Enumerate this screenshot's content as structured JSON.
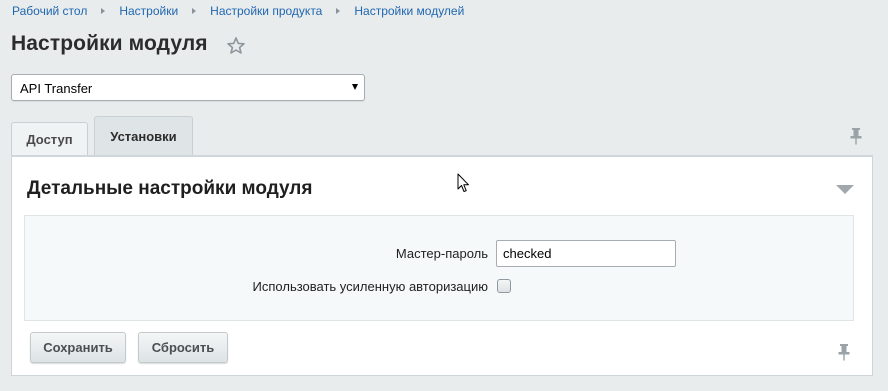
{
  "breadcrumb": [
    "Рабочий стол",
    "Настройки",
    "Настройки продукта",
    "Настройки модулей"
  ],
  "page": {
    "title": "Настройки модуля"
  },
  "module_select": {
    "selected": "API Transfer"
  },
  "tabs": [
    {
      "label": "Доступ",
      "active": false
    },
    {
      "label": "Установки",
      "active": true
    }
  ],
  "section": {
    "title": "Детальные настройки модуля"
  },
  "form": {
    "master_password_label": "Мастер-пароль",
    "master_password_value": "checked",
    "strong_auth_label": "Использовать усиленную авторизацию",
    "strong_auth_checked": false
  },
  "buttons": {
    "save": "Сохранить",
    "reset": "Сбросить"
  },
  "icons": {
    "favorite": "star-icon",
    "pin": "pin-icon",
    "collapse": "triangle-down-icon",
    "cursor": "mouse-pointer-icon"
  },
  "colors": {
    "background": "#e9eced",
    "link": "#2067b0",
    "panel": "#ffffff",
    "form_area": "#f5f9f9"
  }
}
